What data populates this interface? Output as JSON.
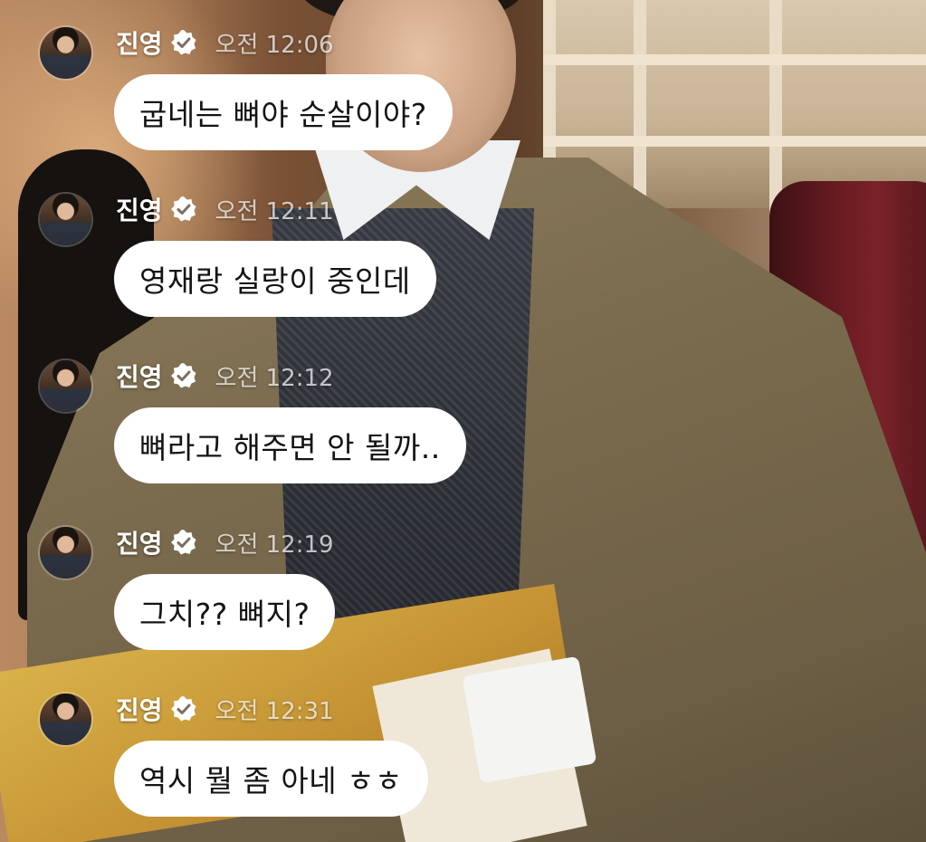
{
  "chat": {
    "messages": [
      {
        "sender": "진영",
        "time": "오전 12:06",
        "text": "굽네는 뼈야 순살이야?"
      },
      {
        "sender": "진영",
        "time": "오전 12:11",
        "text": "영재랑 실랑이 중인데"
      },
      {
        "sender": "진영",
        "time": "오전 12:12",
        "text": "뼈라고 해주면 안 될까.."
      },
      {
        "sender": "진영",
        "time": "오전 12:19",
        "text": "그치?? 뼈지?"
      },
      {
        "sender": "진영",
        "time": "오전 12:31",
        "text": "역시 뭘 좀 아네 ㅎㅎ"
      }
    ]
  },
  "icons": {
    "verified": "verified-check-icon"
  },
  "colors": {
    "bubble": "#ffffff",
    "bubble_text": "#141414",
    "sender": "#ffffff",
    "timestamp": "#d8d2cc"
  }
}
